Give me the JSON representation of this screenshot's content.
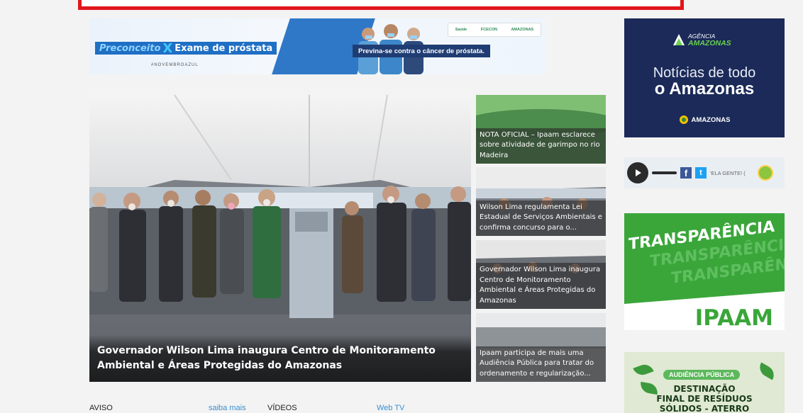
{
  "banner": {
    "left_prefix": "Preconceito",
    "left_x": "X",
    "left_title": "Exame de próstata",
    "hashtag": "#NOVEMBROAZUL",
    "right_text": "Previna-se contra o câncer de próstata.",
    "logos": [
      "Saúde",
      "FCECON",
      "AMAZONAS"
    ]
  },
  "featured": {
    "title": "Governador Wilson Lima inaugura Centro de Monitoramento Ambiental e Áreas Protegidas do Amazonas"
  },
  "side_news": [
    {
      "title": "NOTA OFICIAL – Ipaam esclarece sobre atividade de garimpo no rio Madeira"
    },
    {
      "title": "Wilson Lima regulamenta Lei Estadual de Serviços Ambientais e confirma concurso para o..."
    },
    {
      "title": "Governador Wilson Lima inaugura Centro de Monitoramento Ambiental e Áreas Protegidas do Amazonas"
    },
    {
      "title": "Ipaam participa de mais uma Audiência Pública para tratar do ordenamento e regularização..."
    }
  ],
  "agencia": {
    "logo_small": "AGÊNCIA",
    "logo_big": "AMAZONAS",
    "line1": "Notícias de todo",
    "line2": "o Amazonas",
    "footer": "AMAZONAS"
  },
  "player": {
    "fb": "f",
    "tw": "t",
    "ticker": "'ELA GENTE! ("
  },
  "transparencia": {
    "word": "TRANSPARÊNCIA",
    "word2": "TRANSPARÊNCI",
    "word3": "TRANSPARÊN",
    "org": "IPAAM"
  },
  "audiencia": {
    "pill": "AUDIÊNCIA PÚBLICA",
    "line1": "DESTINAÇÃO",
    "line2": "FINAL DE RESÍDUOS",
    "line3": "SÓLIDOS - ATERRO"
  },
  "bottom": {
    "aviso": "AVISO",
    "saiba_mais": "saiba mais",
    "videos": "VÍDEOS",
    "webtv": "Web TV"
  },
  "colors": {
    "accent_red": "#e0161b",
    "navy": "#1b2a58",
    "green": "#3aa63a",
    "link_blue": "#3a8fd0"
  }
}
